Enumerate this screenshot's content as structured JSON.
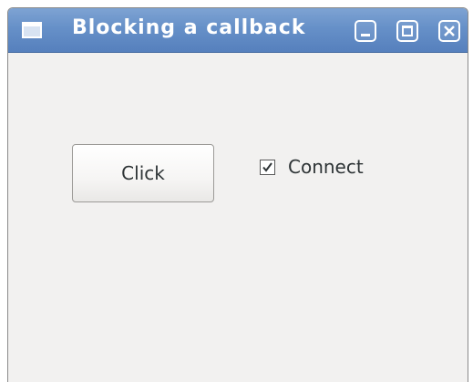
{
  "window": {
    "title": "Blocking a callback",
    "title_icon": "window-icon",
    "controls": {
      "minimize_icon": "minimize-icon",
      "maximize_icon": "maximize-icon",
      "close_icon": "close-icon"
    }
  },
  "content": {
    "button_label": "Click",
    "checkbox": {
      "label": "Connect",
      "checked": true
    }
  },
  "colors": {
    "titlebar": "#6690c8",
    "window_bg": "#f2f1f0",
    "text": "#2e3436"
  }
}
